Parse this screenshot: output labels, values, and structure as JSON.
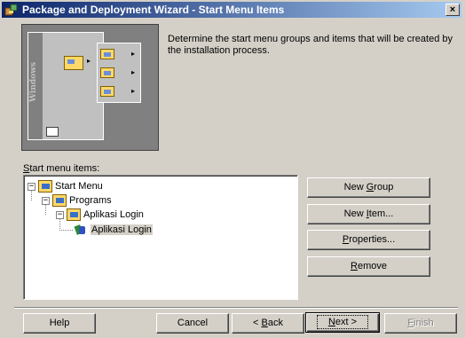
{
  "window": {
    "title": "Package and Deployment Wizard - Start Menu Items",
    "close_label": "×"
  },
  "illustration": {
    "windows_label": "Windows"
  },
  "description": "Determine the start menu groups and items that will be created by the installation process.",
  "start_menu": {
    "label_mnemonic": "S",
    "label_rest": "tart menu items:",
    "tree": [
      {
        "label": "Start Menu",
        "expander": "−"
      },
      {
        "label": "Programs",
        "expander": "−"
      },
      {
        "label": "Aplikasi Login",
        "expander": "−"
      },
      {
        "label": "Aplikasi Login"
      }
    ]
  },
  "side_buttons": {
    "new_group": {
      "pre": "New ",
      "mnemonic": "G",
      "post": "roup"
    },
    "new_item": {
      "pre": "New ",
      "mnemonic": "I",
      "post": "tem..."
    },
    "properties": {
      "pre": "",
      "mnemonic": "P",
      "post": "roperties..."
    },
    "remove": {
      "pre": "",
      "mnemonic": "R",
      "post": "emove"
    }
  },
  "footer_buttons": {
    "help": "Help",
    "cancel": "Cancel",
    "back": {
      "pre": "< ",
      "mnemonic": "B",
      "post": "ack"
    },
    "next": {
      "pre": "",
      "mnemonic": "N",
      "post": "ext >"
    },
    "finish": {
      "pre": "",
      "mnemonic": "F",
      "post": "inish"
    }
  }
}
